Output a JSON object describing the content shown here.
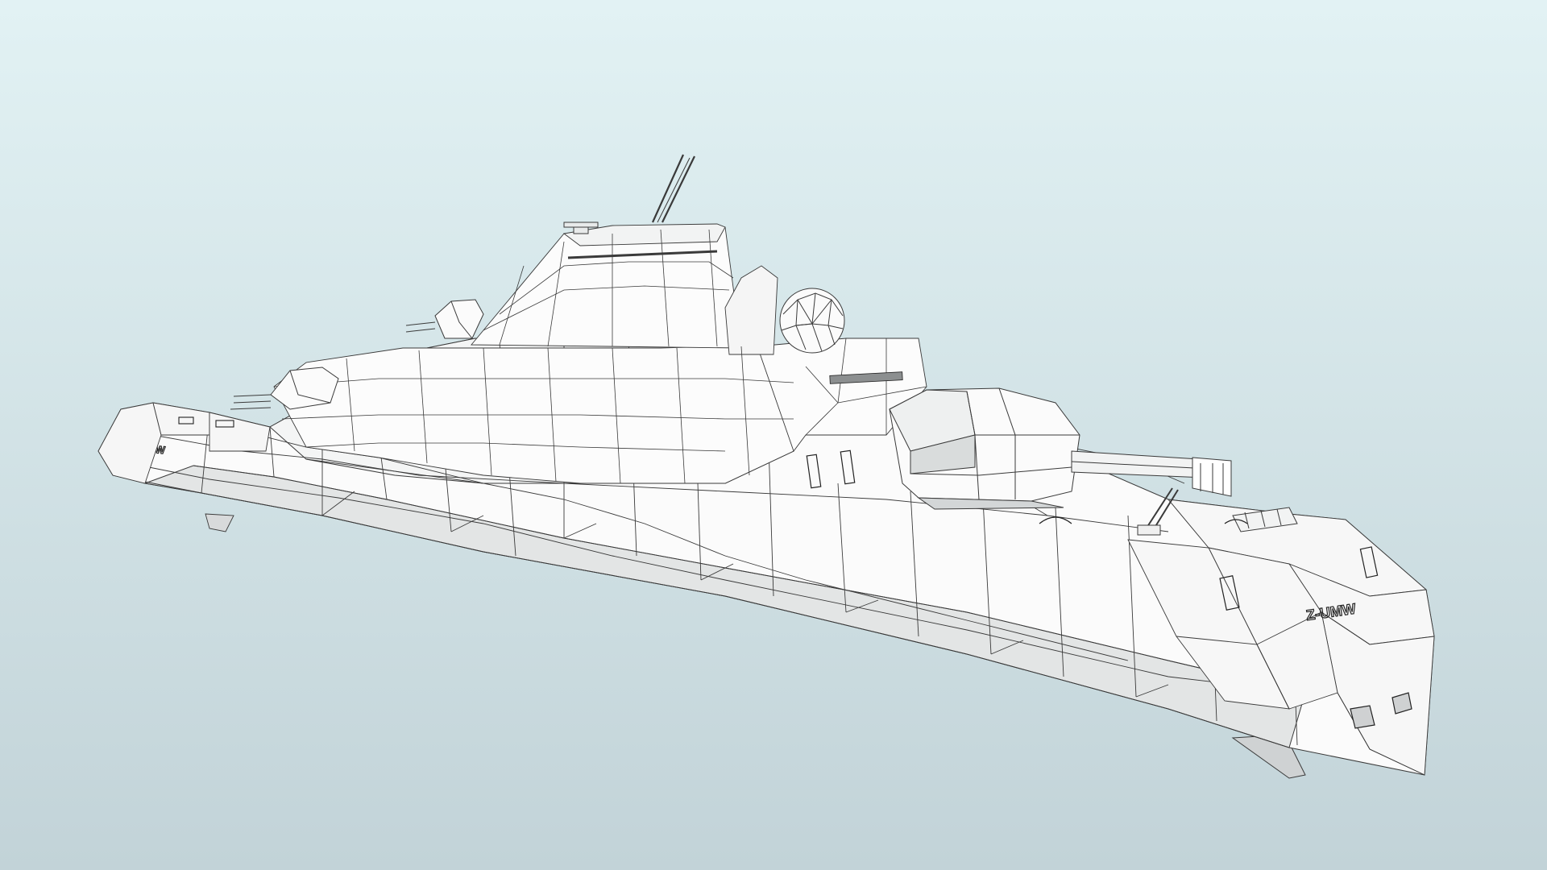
{
  "scene": {
    "subject": "wireframe-stealth-warship-model",
    "background_top": "#e2f2f4",
    "background_bottom": "#c2d3d8",
    "hull_fill": "#fbfbfb",
    "hull_shade": "#e6e8e8",
    "hull_dark": "#d2d5d6",
    "wire_color": "#3a3a3a"
  },
  "markings": {
    "bow_hull_number": "Z-UMW",
    "stern_hull_number": "UMW"
  }
}
